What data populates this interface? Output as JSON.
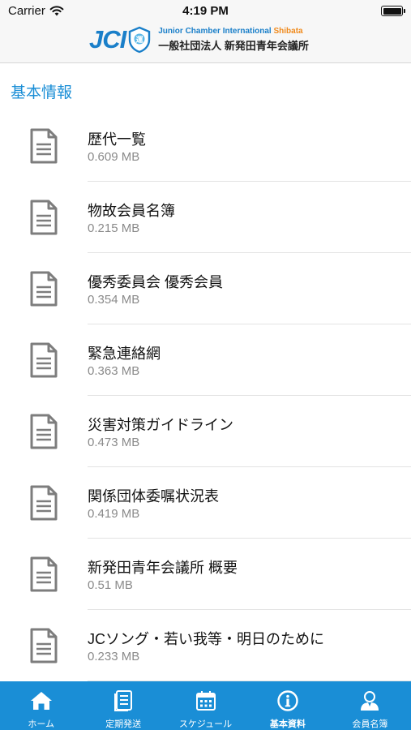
{
  "status_bar": {
    "carrier": "Carrier",
    "time": "4:19 PM",
    "battery_level": 1.0
  },
  "header": {
    "logo_text": "JCI",
    "org_name_en": "Junior Chamber International",
    "org_name_en_city": "Shibata",
    "org_name_jp": "一般社団法人 新発田青年会議所",
    "emblem_char": "運",
    "brand_color": "#1a7fc9",
    "accent_color": "#f08a1c"
  },
  "section": {
    "title": "基本情報"
  },
  "documents": [
    {
      "name": "歴代一覧",
      "size": "0.609 MB",
      "icon": "document-icon"
    },
    {
      "name": "物故会員名簿",
      "size": "0.215 MB",
      "icon": "document-icon"
    },
    {
      "name": "優秀委員会 優秀会員",
      "size": "0.354 MB",
      "icon": "document-icon"
    },
    {
      "name": "緊急連絡網",
      "size": "0.363 MB",
      "icon": "document-icon"
    },
    {
      "name": "災害対策ガイドライン",
      "size": "0.473 MB",
      "icon": "document-icon"
    },
    {
      "name": "関係団体委嘱状況表",
      "size": "0.419 MB",
      "icon": "document-icon"
    },
    {
      "name": "新発田青年会議所 概要",
      "size": "0.51 MB",
      "icon": "document-icon"
    },
    {
      "name": "JCソング・若い我等・明日のために",
      "size": "0.233 MB",
      "icon": "document-icon"
    }
  ],
  "tab_bar": {
    "background": "#1a8ed6",
    "active_tab": "基本資料",
    "tabs": [
      {
        "label": "ホーム",
        "icon": "home-icon"
      },
      {
        "label": "定期発送",
        "icon": "newsletter-icon"
      },
      {
        "label": "スケジュール",
        "icon": "calendar-icon"
      },
      {
        "label": "基本資料",
        "icon": "info-icon"
      },
      {
        "label": "会員名簿",
        "icon": "member-icon"
      }
    ]
  }
}
